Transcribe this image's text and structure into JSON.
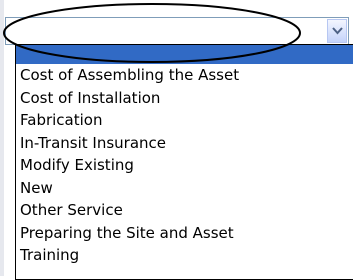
{
  "select": {
    "selected_value": "",
    "options": [
      "",
      "Cost of Assembling the Asset",
      "Cost of Installation",
      "Fabrication",
      "In-Transit Insurance",
      "Modify Existing",
      "New",
      "Other Service",
      "Preparing the Site and Asset",
      "Training"
    ],
    "highlight_color": "#316ac5",
    "border_color": "#7f9db9",
    "arrow_icon": "chevron-down-icon"
  },
  "annotation": {
    "shape": "ellipse",
    "stroke_color": "#000000"
  }
}
